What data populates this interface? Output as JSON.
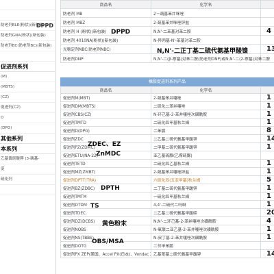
{
  "sidebar": {
    "items": [
      {
        "label": "",
        "kind": "item"
      },
      {
        "label": "",
        "kind": "item"
      },
      {
        "label": "防老剂BLE(粉状)(新包装)",
        "kind": "item",
        "note": "DPPD"
      },
      {
        "label": "防老剂GNA(粉状)(新包装)",
        "kind": "item"
      },
      {
        "label": "防老剂BC(防老剂BC)(新包装)",
        "kind": "item"
      },
      {
        "label": "",
        "kind": "item"
      },
      {
        "label": "促进剂系列",
        "kind": "section"
      },
      {
        "label": "(M)",
        "kind": "item"
      },
      {
        "label": "(MBTS)",
        "kind": "item"
      },
      {
        "label": "(CZ)",
        "kind": "item"
      },
      {
        "label": "促进剂(CZ)",
        "kind": "item"
      },
      {
        "label": "D",
        "kind": "item"
      },
      {
        "label": "(DPG)",
        "kind": "item"
      },
      {
        "label": "其他系列",
        "kind": "section"
      },
      {
        "label": "本系列",
        "kind": "section"
      },
      {
        "label": "乙基黄原酸钾 (3-磷基-",
        "kind": "item"
      },
      {
        "label": "促",
        "kind": "item"
      },
      {
        "label": "硫化剂",
        "kind": "item"
      },
      {
        "label": "",
        "kind": "item"
      }
    ]
  },
  "table1": {
    "headers": [
      "商品名",
      "化学名"
    ],
    "rows": [
      {
        "name": "防老剂 MB",
        "chem": "2－巯基苯并咪唑",
        "value": "",
        "height": "r"
      },
      {
        "name": "防老剂 MBZ",
        "chem": "2-巯基苯并咪唑锌盐",
        "value": "",
        "height": "r"
      },
      {
        "name": "防老剂 H (粉状)(新包装)",
        "chem": "N,N'-二苯基对苯二胺",
        "value": "4",
        "height": "r"
      },
      {
        "name": "防老剂 4010NA(粉状)(新包装)",
        "chem": "N-异丙基-N'-苯基对苯二胺",
        "value": "",
        "height": "r"
      },
      {
        "name": "光稳定剂NBC(防老剂NBC)",
        "chem": "",
        "value": "13",
        "height": "r2"
      },
      {
        "name": "防老剂DNP",
        "chem": "N,N'-二(β-萘基)对苯二胺(防老剂DNP)或N,N'-二(2-萘基)对苯二胺",
        "value": "",
        "height": "r"
      }
    ]
  },
  "table1_annotations": {
    "dppd": "DPPD",
    "nbc": "N,N'-二正丁基二硫代氨基甲酸镍"
  },
  "banner": {
    "title": "橡胶促进剂系列产品"
  },
  "table2": {
    "headers": [
      "商品名",
      "化学名"
    ],
    "rows": [
      {
        "name": "促进剂M(MBT)",
        "chem": "2-巯基苯并噻唑",
        "value": "1",
        "hilite": false
      },
      {
        "name": "促进剂DM(MBTS)",
        "chem": "二硫化二苯并噻唑",
        "value": "1",
        "hilite": false
      },
      {
        "name": "促进剂CBS(CZ)",
        "chem": "N-环己基-2-苯并噻唑次磺酰胺",
        "value": "1",
        "hilite": false
      },
      {
        "name": "促进剂TMTD",
        "chem": "二硫化四甲基秋兰姆",
        "value": "1",
        "hilite": false
      },
      {
        "name": "促进剂D(DPG)",
        "chem": "二苯胍",
        "value": "8",
        "hilite": false
      },
      {
        "name": "促进剂ZDC",
        "chem": "二乙基二硫代氨基甲酸锌",
        "value": "14",
        "hilite": false
      },
      {
        "name": "促进剂PZ(ZDMC)",
        "chem": "二甲基二硫代氨基甲酸锌",
        "value": "1",
        "hilite": false
      },
      {
        "name": "促进剂ETU(NA-22)",
        "chem": "亚乙基硫脲(乙撑硫脲)",
        "value": "",
        "hilite": false
      },
      {
        "name": "促进剂TETD",
        "chem": "二硫化四乙基秋兰姆",
        "value": "1",
        "hilite": false
      },
      {
        "name": "促进剂MZ(ZMBT)",
        "chem": "2-巯基苯并噻唑锌盐",
        "value": "1",
        "hilite": false
      },
      {
        "name": "促进剂DPTT(TRA)",
        "chem": "六硫化双(五亚甲基)秋兰姆",
        "value": "5",
        "hilite": true
      },
      {
        "name": "促进剂BZ(ZDBC)",
        "chem": "二丁基二硫代氨基甲酸锌",
        "value": "1",
        "hilite": false
      },
      {
        "name": "促进剂TMTM",
        "chem": "一硫化四甲基秋兰姆",
        "value": "1",
        "hilite": false
      },
      {
        "name": "促进剂DTDM",
        "chem": "4,4'-二硫代二吗啉",
        "value": "1",
        "hilite": false
      },
      {
        "name": "促进剂TDEC",
        "chem": "二乙基二硫代氨基甲酸碲",
        "value": "20",
        "hilite": false
      },
      {
        "name": "促进剂DZ(DCBS)",
        "chem": "N,N'-二环己基-2-苯并噻唑次磺酰胺",
        "value": "4",
        "hilite": false
      },
      {
        "name": "促进剂NOBS",
        "chem": "N-氧联二亚乙基-2-苯并噻唑次磺酰胺",
        "value": "1",
        "hilite": false
      },
      {
        "name": "促进剂NS(TBBS)",
        "chem": "N-叔丁基-2-苯并噻唑次磺酰胺",
        "value": "1",
        "hilite": false
      },
      {
        "name": "促进剂DOTG",
        "chem": "二邻甲苯胍",
        "value": "",
        "hilite": false
      },
      {
        "name": "促进剂PX  ZEP(美国、Accel PX(日本)、Vondac ZEP(英国))",
        "chem": "乙基苯基二硫代氨基甲酸锌",
        "value": "14",
        "hilite": false
      }
    ]
  },
  "table2_annotations": {
    "zdec": "ZDEC、EZ",
    "zmdc": "ZnMDC",
    "dpth": "DPTH",
    "ts": "TS",
    "powder": "黄色粉末",
    "obs": "OBS/MSA"
  }
}
